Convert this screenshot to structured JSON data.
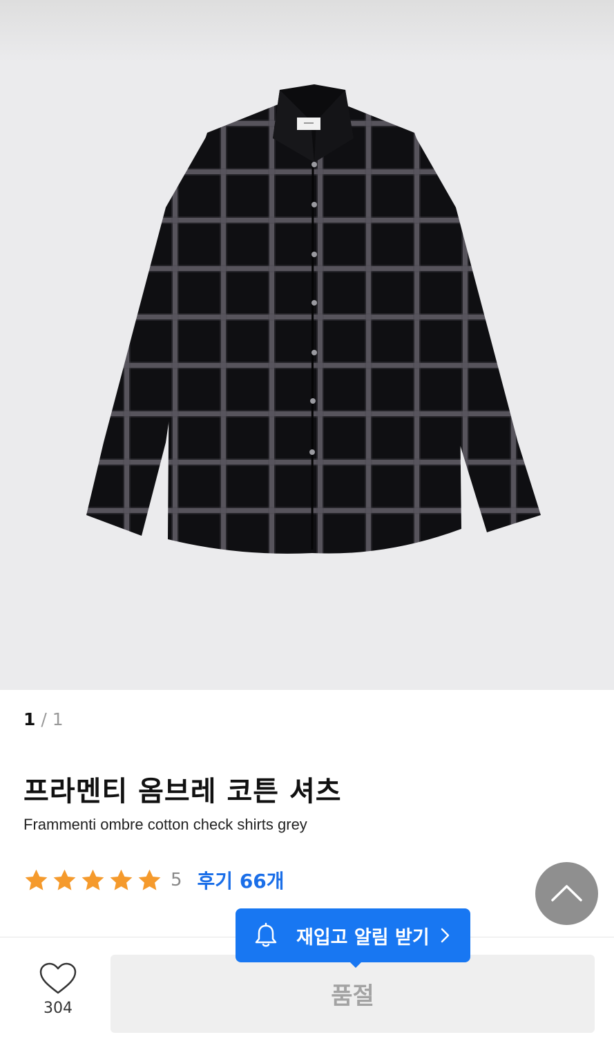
{
  "gallery": {
    "current": "1",
    "separator": " / ",
    "total": "1"
  },
  "product": {
    "name_ko": "프라멘티 옴브레 코튼 셔츠",
    "name_en": "Frammenti ombre cotton check shirts grey",
    "rating": "5",
    "stars": 5,
    "review_link": "후기 66개"
  },
  "restock_button": {
    "label": "재입고 알림 받기"
  },
  "wishlist": {
    "count": "304"
  },
  "buy_button": {
    "label": "품절"
  },
  "colors": {
    "accent": "#1877f2",
    "review_link": "#1a6ee8",
    "star": "#f59a2c",
    "hero_bg": "#ebebed"
  },
  "icons": [
    "shirt-product-image",
    "star-icon",
    "chevron-up-icon",
    "bell-icon",
    "chevron-right-icon",
    "heart-icon"
  ]
}
